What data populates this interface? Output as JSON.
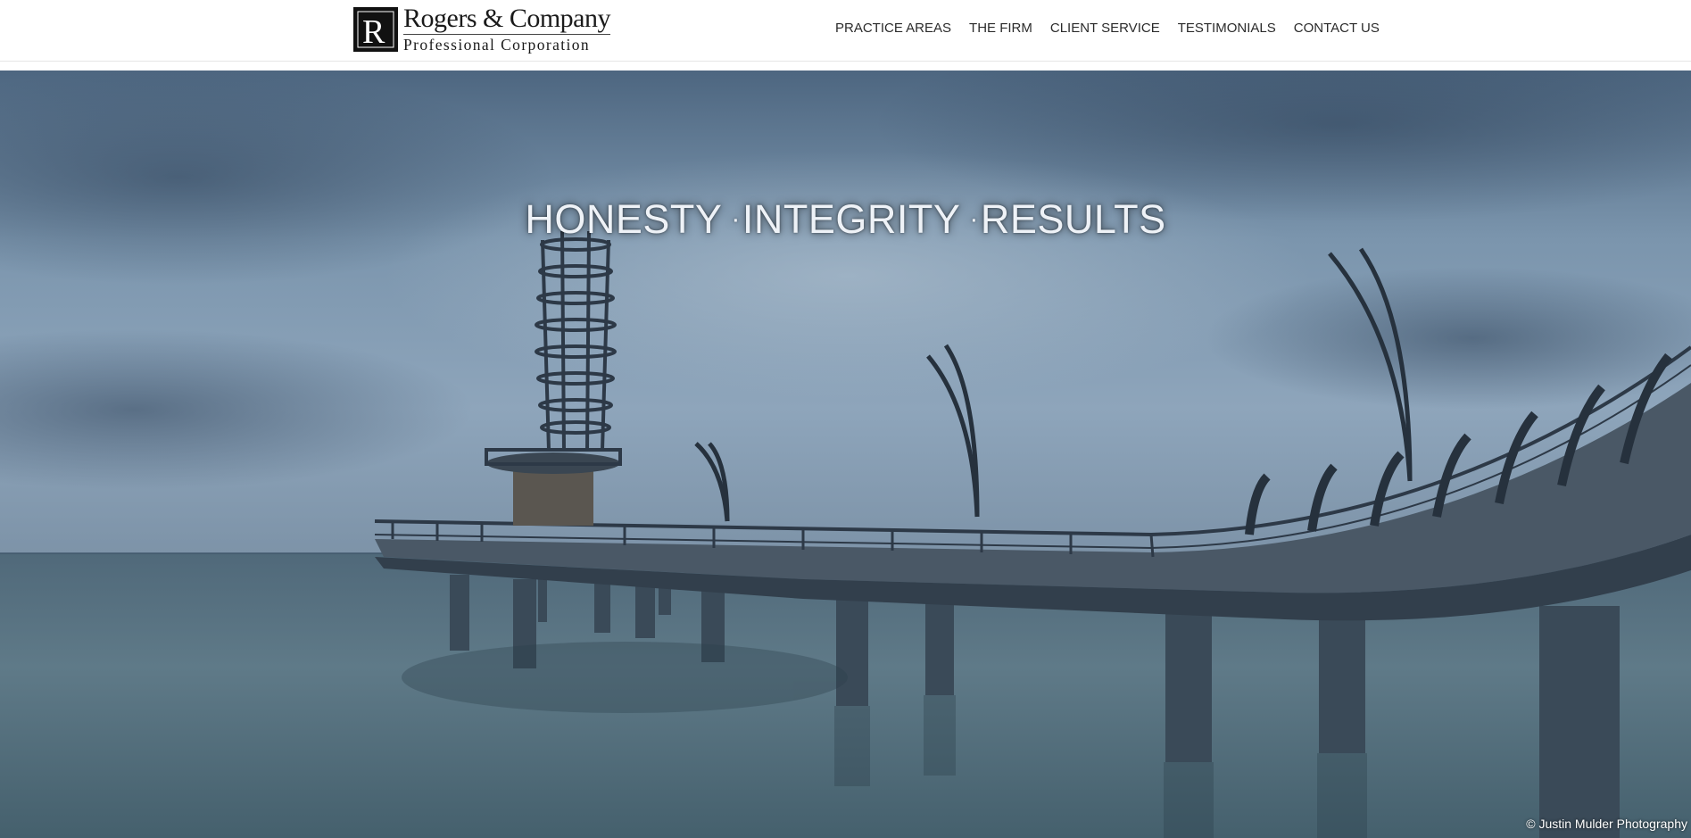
{
  "header": {
    "logo": {
      "monogram": "R",
      "name": "Rogers & Company",
      "subtitle": "Professional Corporation"
    },
    "nav": [
      {
        "label": "PRACTICE AREAS"
      },
      {
        "label": "THE FIRM"
      },
      {
        "label": "CLIENT SERVICE"
      },
      {
        "label": "TESTIMONIALS"
      },
      {
        "label": "CONTACT US"
      }
    ]
  },
  "hero": {
    "image_subject": "pier-photo",
    "tagline": {
      "word1": "HONESTY",
      "word2": "INTEGRITY",
      "word3": "RESULTS",
      "separator": "·"
    },
    "photo_credit": "© Justin Mulder Photography"
  },
  "colors": {
    "header_bg": "#ffffff",
    "nav_text": "#2b2b2b",
    "sky": "#6f8aa4",
    "water": "#5b7584",
    "structure": "#2d3947"
  }
}
